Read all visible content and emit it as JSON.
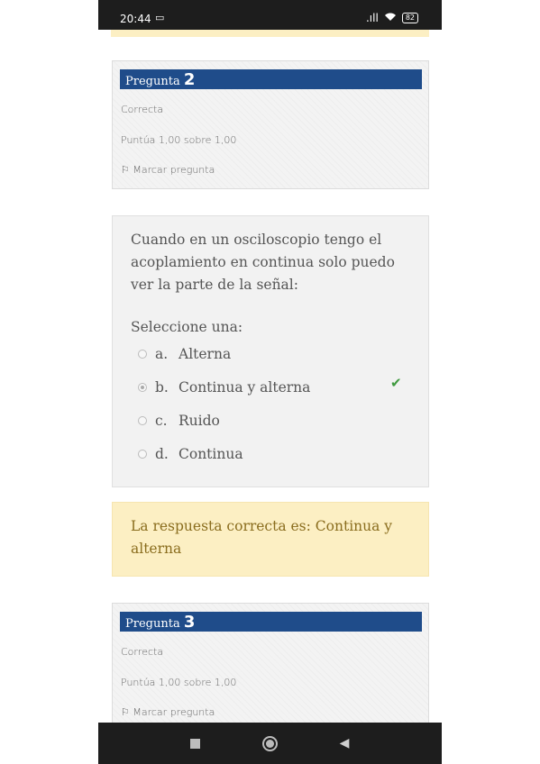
{
  "status_bar": {
    "time": "20:44",
    "signal": ".ıll",
    "battery": "82"
  },
  "question2_info": {
    "prefix": "Pregunta",
    "number": "2",
    "status": "Correcta",
    "score": "Puntúa 1,00 sobre 1,00",
    "flag_label": "Marcar pregunta"
  },
  "question": {
    "text": "Cuando en un osciloscopio tengo el acoplamiento en continua solo puedo ver la parte de la señal:",
    "select_label": "Seleccione una:",
    "options": [
      {
        "letter": "a.",
        "label": "Alterna"
      },
      {
        "letter": "b.",
        "label": "Continua y alterna"
      },
      {
        "letter": "c.",
        "label": "Ruido"
      },
      {
        "letter": "d.",
        "label": "Continua"
      }
    ],
    "selected_option": "b.",
    "correct_mark": "✔"
  },
  "feedback": {
    "text": "La respuesta correcta es: Continua y alterna"
  },
  "question3_info": {
    "prefix": "Pregunta",
    "number": "3",
    "status": "Correcta",
    "score": "Puntúa 1,00 sobre 1,00",
    "flag_label": "Marcar pregunta"
  },
  "nav": {
    "recents_icon": "square-icon",
    "home_icon": "circle-icon",
    "back_icon": "triangle-back-icon"
  },
  "colors": {
    "header_blue": "#1f4c8a",
    "feedback_bg": "#fcefc3",
    "check_green": "#3f9a3f"
  }
}
